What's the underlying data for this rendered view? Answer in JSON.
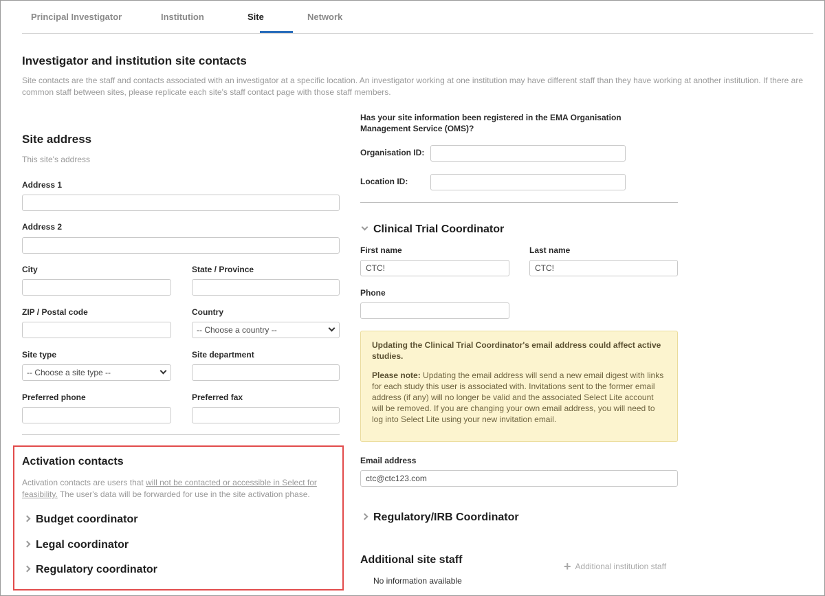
{
  "tabs": [
    {
      "label": "Principal Investigator"
    },
    {
      "label": "Institution"
    },
    {
      "label": "Site"
    },
    {
      "label": "Network"
    }
  ],
  "header": {
    "title": "Investigator and institution site contacts",
    "description": "Site contacts are the staff and contacts associated with an investigator at a specific location. An investigator working at one institution may have different staff than they have working at another institution. If there are common staff between sites, please replicate each site's staff contact page with those staff members."
  },
  "site_address": {
    "title": "Site address",
    "help": "This site's address",
    "address1_label": "Address 1",
    "address2_label": "Address 2",
    "city_label": "City",
    "state_label": "State / Province",
    "zip_label": "ZIP / Postal code",
    "country_label": "Country",
    "country_value": "-- Choose a country --",
    "site_type_label": "Site type",
    "site_type_value": "-- Choose a site type --",
    "site_department_label": "Site department",
    "preferred_phone_label": "Preferred phone",
    "preferred_fax_label": "Preferred fax"
  },
  "activation": {
    "title": "Activation contacts",
    "help_prefix": "Activation contacts are users that ",
    "help_link1": "will not be contacted or accessible in Select for",
    "help_link2": "feasibility.",
    "help_suffix": " The user's data will be forwarded for use in the site activation phase.",
    "items": [
      {
        "label": "Budget coordinator"
      },
      {
        "label": "Legal coordinator"
      },
      {
        "label": "Regulatory coordinator"
      }
    ]
  },
  "oms": {
    "question_line1": "Has your site information been registered in the EMA Organisation",
    "question_line2": "Management Service (OMS)?",
    "org_id_label": "Organisation ID:",
    "location_id_label": "Location ID:"
  },
  "ctc": {
    "title": "Clinical Trial Coordinator",
    "first_name_label": "First name",
    "first_name_value": "CTC!",
    "last_name_label": "Last name",
    "last_name_value": "CTC!",
    "phone_label": "Phone",
    "notice_title": "Updating the Clinical Trial Coordinator's email address could affect active studies.",
    "notice_bold": "Please note:",
    "notice_text": " Updating the email address will send a new email digest with links for each study this user is associated with. Invitations sent to the former email address (if any) will no longer be valid and the associated Select Lite account will be removed. If you are changing your own email address, you will need to log into Select Lite using your new invitation email.",
    "email_label": "Email address",
    "email_value": "ctc@ctc123.com"
  },
  "regulatory_irb": {
    "title": "Regulatory/IRB Coordinator"
  },
  "additional_staff": {
    "title": "Additional site staff",
    "add_label": "Additional institution staff",
    "empty_text": "No information available"
  }
}
